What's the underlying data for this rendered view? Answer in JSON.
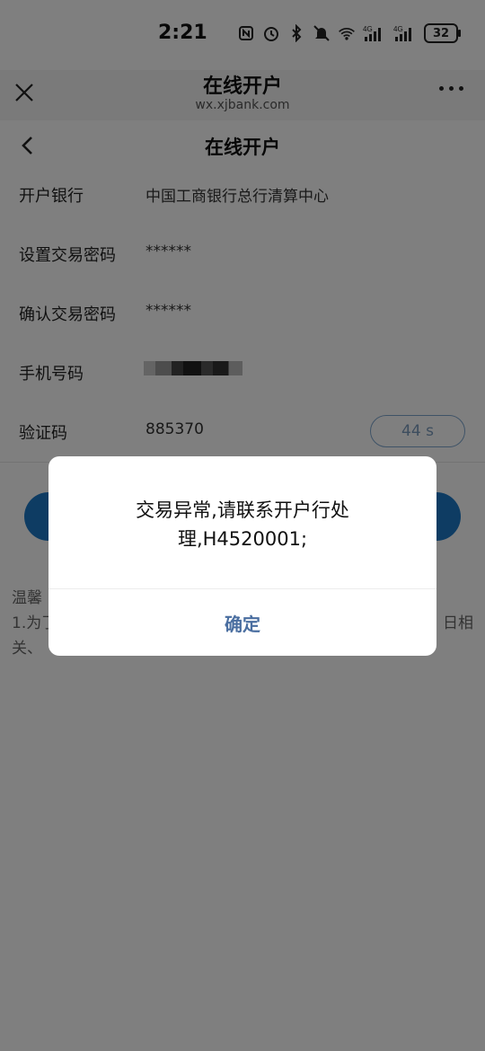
{
  "status_bar": {
    "time": "2:21",
    "battery": "32",
    "icons": [
      "nfc-icon",
      "alarm-icon",
      "bluetooth-icon",
      "mute-icon",
      "wifi-icon",
      "signal-4g-icon",
      "signal-4g-icon"
    ]
  },
  "browser": {
    "title": "在线开户",
    "url": "wx.xjbank.com"
  },
  "page": {
    "title": "在线开户"
  },
  "form": {
    "rows": [
      {
        "label": "开户银行",
        "value": "中国工商银行总行清算中心"
      },
      {
        "label": "设置交易密码",
        "value": "******"
      },
      {
        "label": "确认交易密码",
        "value": "******"
      },
      {
        "label": "手机号码",
        "value": ""
      },
      {
        "label": "验证码",
        "value": "885370"
      }
    ],
    "countdown": "44 s"
  },
  "tips": {
    "line1": "温馨",
    "line2": "1.为了",
    "line2_end": "日相",
    "line3": "关、"
  },
  "dialog": {
    "message": "交易异常,请联系开户行处理,H4520001;",
    "confirm": "确定"
  },
  "colors": {
    "primary": "#1c79c7",
    "dialog_button": "#4a6ea0",
    "countdown_border": "#7ea6cf"
  }
}
